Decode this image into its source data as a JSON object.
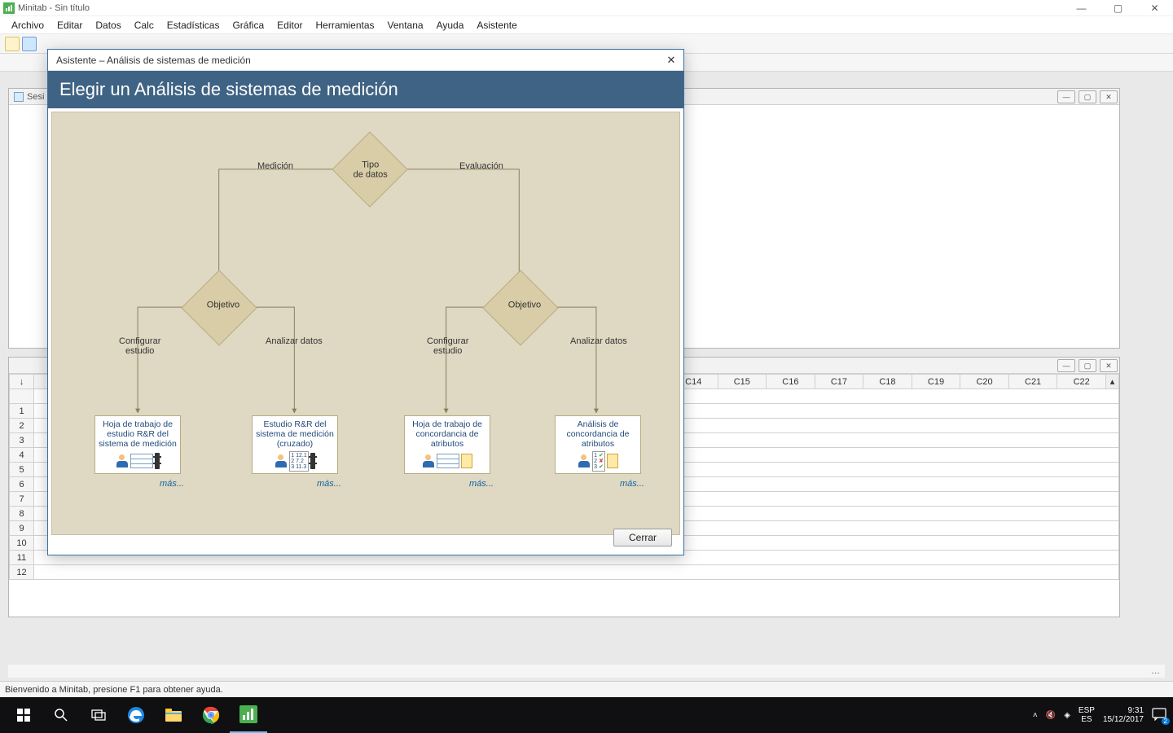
{
  "titlebar": {
    "app": "Minitab",
    "doc": "Sin título"
  },
  "menu": [
    "Archivo",
    "Editar",
    "Datos",
    "Calc",
    "Estadísticas",
    "Gráfica",
    "Editor",
    "Herramientas",
    "Ventana",
    "Ayuda",
    "Asistente"
  ],
  "session_window_title": "Sesi",
  "worksheet": {
    "columns": [
      "C14",
      "C15",
      "C16",
      "C17",
      "C18",
      "C19",
      "C20",
      "C21",
      "C22"
    ],
    "rows": [
      "1",
      "2",
      "3",
      "4",
      "5",
      "6",
      "7",
      "8",
      "9",
      "10",
      "11",
      "12"
    ]
  },
  "window_buttons": {
    "min": "—",
    "max": "▢",
    "close": "✕"
  },
  "dialog": {
    "title": "Asistente – Análisis de sistemas de medición",
    "banner": "Elegir un Análisis de sistemas de medición",
    "diamonds": {
      "tipo": "Tipo\nde datos",
      "objetivo_left": "Objetivo",
      "objetivo_right": "Objetivo"
    },
    "branches": {
      "medicion": "Medición",
      "evaluacion": "Evaluación",
      "configurar_left": "Configurar\nestudio",
      "analizar_left": "Analizar datos",
      "configurar_right": "Configurar\nestudio",
      "analizar_right": "Analizar datos"
    },
    "cards": {
      "c1": "Hoja de trabajo de estudio R&R del sistema de medición",
      "c2": "Estudio R&R del sistema de medición (cruzado)",
      "c3": "Hoja de trabajo de concordancia de atributos",
      "c4": "Análisis de concordancia de atributos"
    },
    "card2_rows": [
      "1  12.1",
      "2   7.2",
      "3  11.3"
    ],
    "card4_rows": [
      "1",
      "2",
      "3"
    ],
    "more": "más...",
    "close_btn": "Cerrar"
  },
  "status": "Bienvenido a Minitab, presione F1 para obtener ayuda.",
  "tray": {
    "lang1": "ESP",
    "lang2": "ES",
    "time": "9:31",
    "date": "15/12/2017",
    "notif": "2"
  },
  "nav_indicator": "…"
}
